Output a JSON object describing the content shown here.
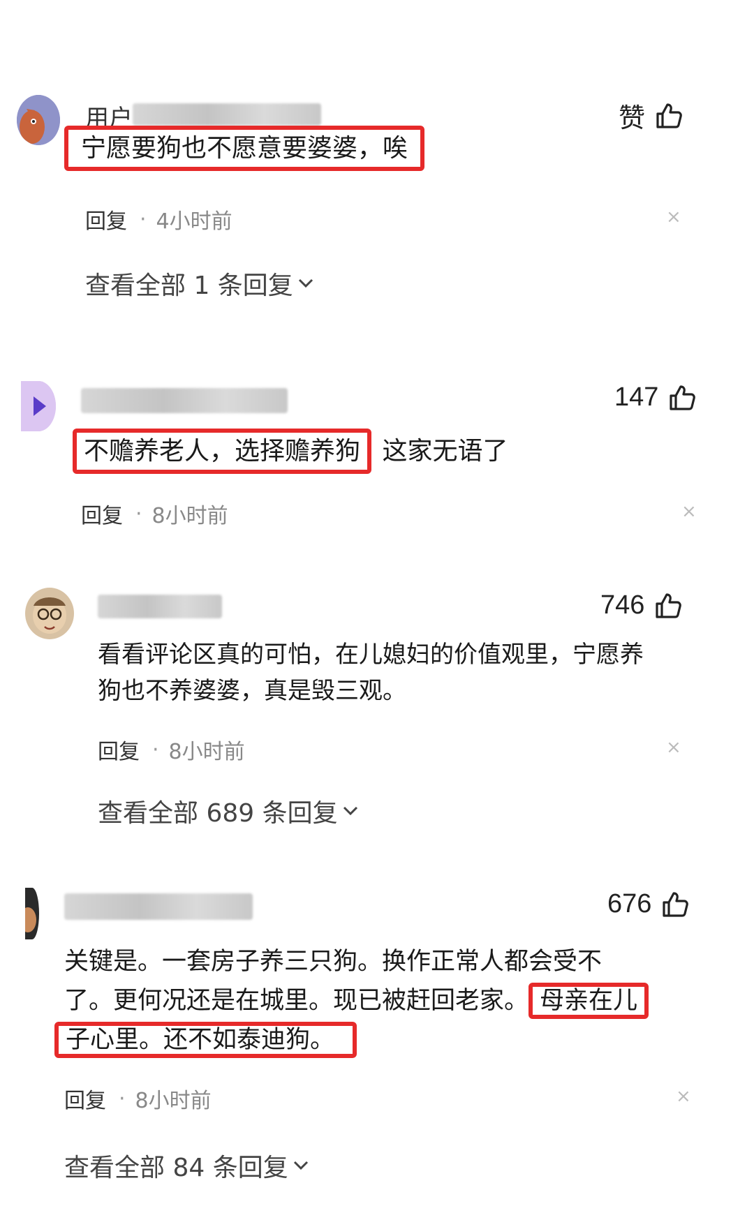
{
  "comments": [
    {
      "username": "用户",
      "like_label": "赞",
      "text_highlight": "宁愿要狗也不愿意要婆婆，唉",
      "text_rest": "",
      "reply_label": "回复",
      "separator": "·",
      "time": "4小时前",
      "dismiss": "×",
      "view_all": "查看全部 1 条回复"
    },
    {
      "username": "",
      "like_label": "147",
      "text_highlight": "不赡养老人，选择赡养狗",
      "text_rest": "这家无语了",
      "reply_label": "回复",
      "separator": "·",
      "time": "8小时前",
      "dismiss": "×"
    },
    {
      "username": "",
      "like_label": "746",
      "text_line1": "看看评论区真的可怕，在儿媳妇的价值观里，宁愿养",
      "text_line2": "狗也不养婆婆，真是毁三观。",
      "reply_label": "回复",
      "separator": "·",
      "time": "8小时前",
      "dismiss": "×",
      "view_all": "查看全部 689 条回复"
    },
    {
      "username": "",
      "like_label": "676",
      "text_line1": "关键是。一套房子养三只狗。换作正常人都会受不",
      "text_line2_plain": "了。更何况还是在城里。现已被赶回老家。",
      "text_line2_highlight": "母亲在儿",
      "text_line3_highlight": "子心里。还不如泰迪狗。",
      "reply_label": "回复",
      "separator": "·",
      "time": "8小时前",
      "dismiss": "×",
      "view_all": "查看全部 84 条回复"
    }
  ],
  "icons": {
    "like": "thumbs-up-icon",
    "expand": "chevron-down-icon"
  },
  "colors": {
    "highlight": "#e62a2a",
    "text": "#1a1a1a",
    "meta": "#888888"
  }
}
